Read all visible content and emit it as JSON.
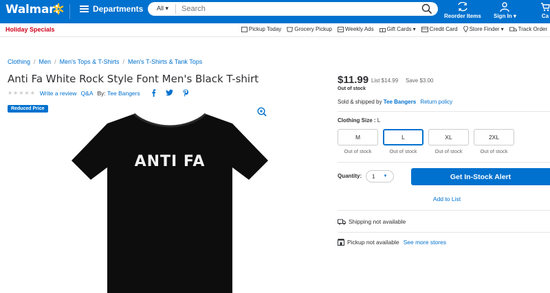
{
  "header": {
    "logo": "Walmart",
    "departments": "Departments",
    "search_category": "All",
    "search_placeholder": "Search",
    "reorder": "Reorder Items",
    "signin": "Sign In",
    "cart": "Ca"
  },
  "subnav": {
    "holiday": "Holiday Specials",
    "links": [
      "Pickup Today",
      "Grocery Pickup",
      "Weekly Ads",
      "Gift Cards",
      "Credit Card",
      "Store Finder",
      "Track Order"
    ]
  },
  "breadcrumb": [
    "Clothing",
    "Men",
    "Men's Tops & T-Shirts",
    "Men's T-Shirts & Tank Tops"
  ],
  "product": {
    "title": "Anti Fa White Rock Style Font Men's Black T-shirt",
    "stars": "★★★★★",
    "write_review": "Write a review",
    "qa": "Q&A",
    "by_label": "By:",
    "brand": "Tee Bangers",
    "badge": "Reduced Price",
    "shirt_text": "ANTI FA"
  },
  "pricing": {
    "price": "$11.99",
    "list": "List $14.99",
    "save": "Save $3.00",
    "stock": "Out of stock",
    "sold_prefix": "Sold & shipped by",
    "seller": "Tee Bangers",
    "return_policy": "Return policy"
  },
  "sizes": {
    "label": "Clothing Size :",
    "selected": "L",
    "options": [
      {
        "label": "M",
        "status": "Out of stock"
      },
      {
        "label": "L",
        "status": "Out of stock"
      },
      {
        "label": "XL",
        "status": "Out of stock"
      },
      {
        "label": "2XL",
        "status": "Out of stock"
      }
    ]
  },
  "purchase": {
    "quantity_label": "Quantity:",
    "quantity": "1",
    "alert_button": "Get In-Stock Alert",
    "add_to_list": "Add to List",
    "shipping": "Shipping not available",
    "pickup": "Pickup not available",
    "see_stores": "See more stores"
  },
  "colors": {
    "brand_blue": "#0071ce",
    "spark_yellow": "#ffc220",
    "holiday_red": "#d0021b"
  }
}
